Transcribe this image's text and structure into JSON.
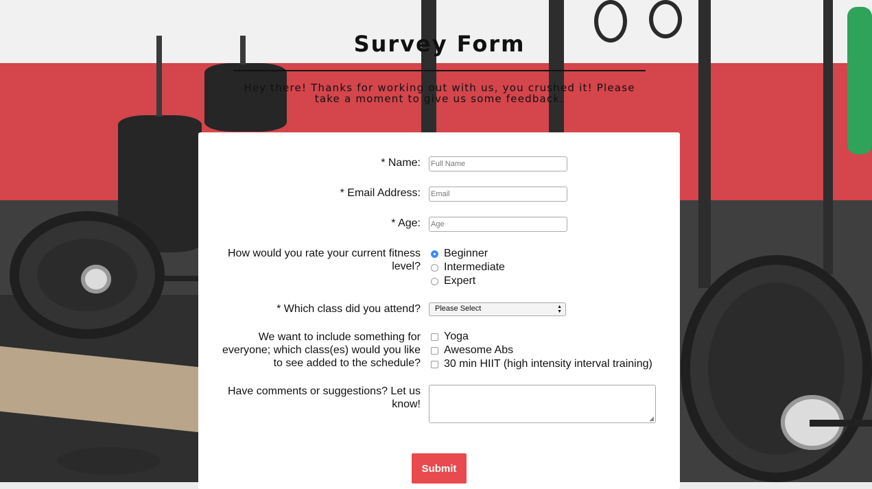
{
  "header": {
    "title": "Survey Form",
    "subtitle": "Hey there! Thanks for working out with us, you crushed it! Please take a moment to give us some feedback."
  },
  "form": {
    "name": {
      "label": "* Name:",
      "placeholder": "Full Name"
    },
    "email": {
      "label": "* Email Address:",
      "placeholder": "Email"
    },
    "age": {
      "label": "* Age:",
      "placeholder": "Age"
    },
    "fitness": {
      "label": "How would you rate your current fitness level?",
      "options": [
        "Beginner",
        "Intermediate",
        "Expert"
      ],
      "selected": "Beginner"
    },
    "class": {
      "label": "* Which class did you attend?",
      "selected": "Please Select"
    },
    "additions": {
      "label": "We want to include something for everyone; which class(es) would you like to see added to the schedule?",
      "options": [
        "Yoga",
        "Awesome Abs",
        "30 min HIIT (high intensity interval training)"
      ]
    },
    "comments": {
      "label": "Have comments or suggestions? Let us know!"
    },
    "submit_label": "Submit"
  },
  "colors": {
    "submit_bg": "#e84a4d",
    "radio_checked": "#3d8ef0",
    "wall_red": "#d4454c"
  }
}
